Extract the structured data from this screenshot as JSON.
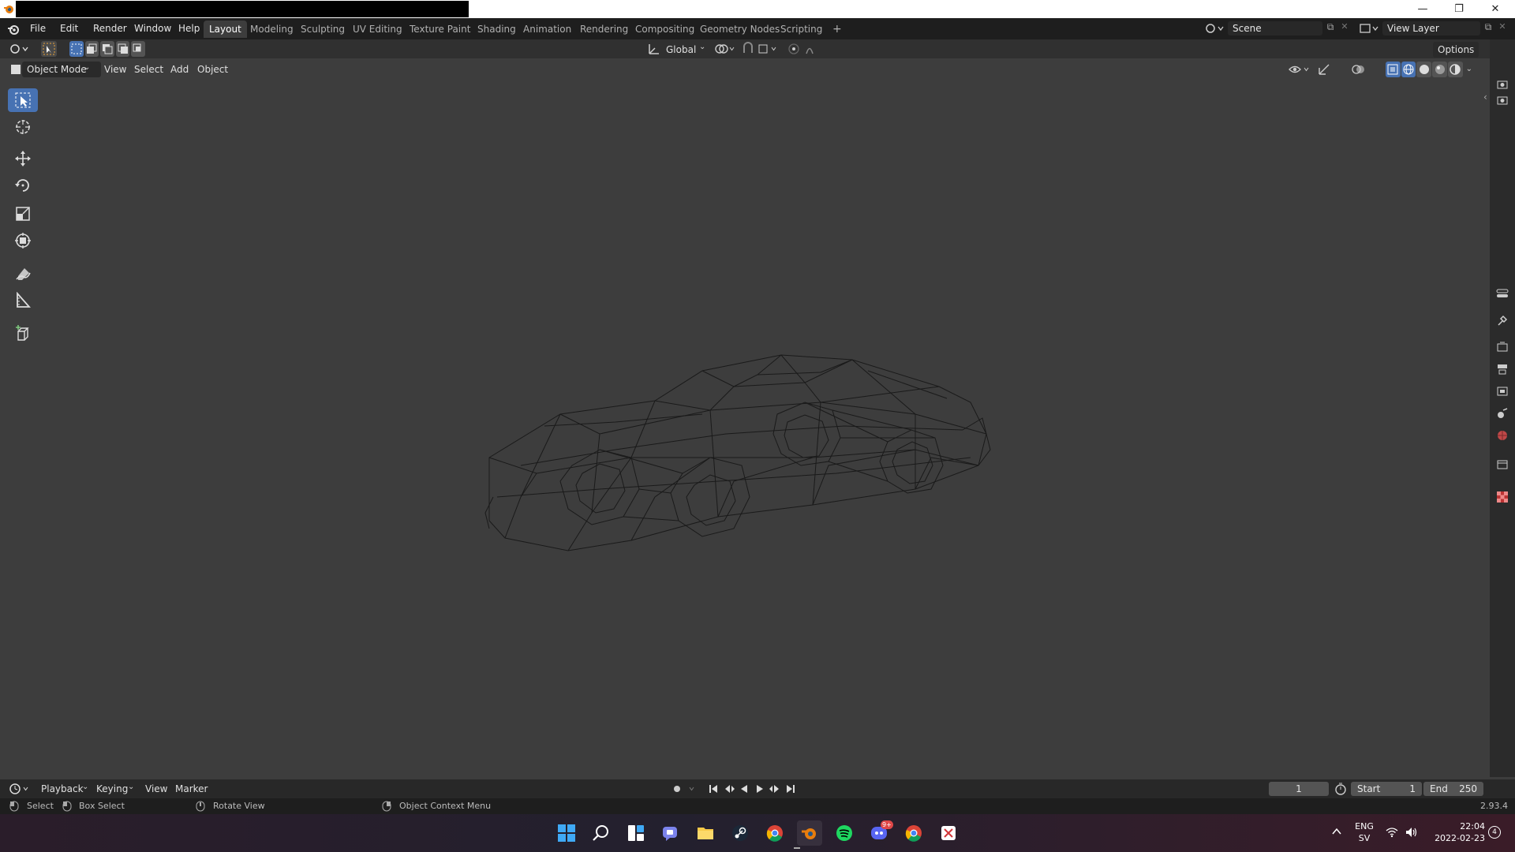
{
  "menu": {
    "file": "File",
    "edit": "Edit",
    "render": "Render",
    "window": "Window",
    "help": "Help"
  },
  "workspaces": [
    "Layout",
    "Modeling",
    "Sculpting",
    "UV Editing",
    "Texture Paint",
    "Shading",
    "Animation",
    "Rendering",
    "Compositing",
    "Geometry Nodes",
    "Scripting"
  ],
  "add_workspace": "+",
  "scene": {
    "label": "Scene"
  },
  "view_layer": {
    "label": "View Layer"
  },
  "tool_header": {
    "orientation": "Global",
    "options": "Options"
  },
  "view_header": {
    "mode": "Object Mode",
    "view": "View",
    "select": "Select",
    "add": "Add",
    "object": "Object"
  },
  "timeline": {
    "playback": "Playback",
    "keying": "Keying",
    "view": "View",
    "marker": "Marker",
    "current_frame": "1",
    "start_label": "Start",
    "start": "1",
    "end_label": "End",
    "end": "250"
  },
  "status": {
    "select": "Select",
    "box_select": "Box Select",
    "rotate_view": "Rotate View",
    "context_menu": "Object Context Menu",
    "version": "2.93.4"
  },
  "tray": {
    "lang1": "ENG",
    "lang2": "SV",
    "time": "22:04",
    "date": "2022-02-23",
    "notifications": "4",
    "discord_badge": "9+"
  },
  "colors": {
    "accent": "#4772b3",
    "viewport": "#3d3d3d",
    "topbar": "#1e1e1e"
  },
  "icons": [
    "blender-logo",
    "select-box-icon",
    "cursor-icon",
    "move-icon",
    "rotate-icon",
    "scale-icon",
    "transform-icon",
    "annotate-icon",
    "measure-icon",
    "add-cube-icon"
  ]
}
